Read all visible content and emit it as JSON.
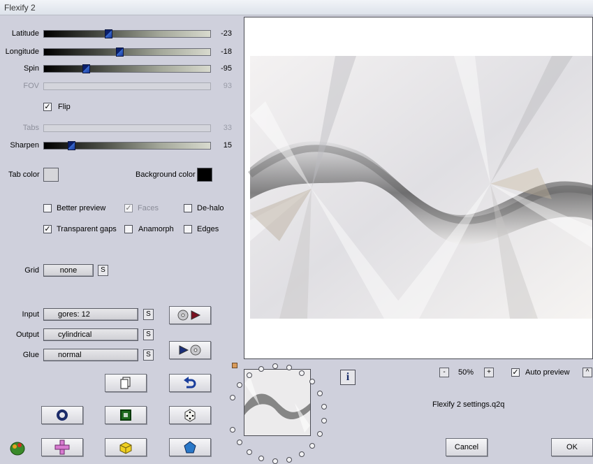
{
  "window": {
    "title": "Flexify 2"
  },
  "sliders": [
    {
      "label": "Latitude",
      "value": "-23",
      "position": 0.38,
      "enabled": true
    },
    {
      "label": "Longitude",
      "value": "-18",
      "position": 0.45,
      "enabled": true
    },
    {
      "label": "Spin",
      "value": "-95",
      "position": 0.24,
      "enabled": true
    },
    {
      "label": "FOV",
      "value": "93",
      "position": null,
      "enabled": false
    },
    {
      "label": "Tabs",
      "value": "33",
      "position": null,
      "enabled": false
    },
    {
      "label": "Sharpen",
      "value": "15",
      "position": 0.15,
      "enabled": true
    }
  ],
  "flip": {
    "label": "Flip",
    "checked": true
  },
  "tab_color": {
    "label": "Tab color",
    "color": "#d6d6da"
  },
  "background_color": {
    "label": "Background color",
    "color": "#000000"
  },
  "checkboxes": {
    "better_preview": {
      "label": "Better preview",
      "checked": false
    },
    "faces": {
      "label": "Faces",
      "checked": true,
      "enabled": false
    },
    "de_halo": {
      "label": "De-halo",
      "checked": false
    },
    "transparent_gaps": {
      "label": "Transparent gaps",
      "checked": true
    },
    "anamorph": {
      "label": "Anamorph",
      "checked": false
    },
    "edges": {
      "label": "Edges",
      "checked": false
    }
  },
  "grid": {
    "label": "Grid",
    "value": "none",
    "s_label": "S"
  },
  "input": {
    "label": "Input",
    "value": "gores: 12",
    "s_label": "S"
  },
  "output": {
    "label": "Output",
    "value": "cylindrical",
    "s_label": "S"
  },
  "glue": {
    "label": "Glue",
    "value": "normal",
    "s_label": "S"
  },
  "zoom": {
    "minus": "-",
    "value": "50%",
    "plus": "+"
  },
  "auto_preview": {
    "label": "Auto preview",
    "checked": true,
    "up_label": "^"
  },
  "settings_file": "Flexify 2 settings.q2q",
  "info_label": "i",
  "buttons": {
    "cancel": "Cancel",
    "ok": "OK"
  }
}
